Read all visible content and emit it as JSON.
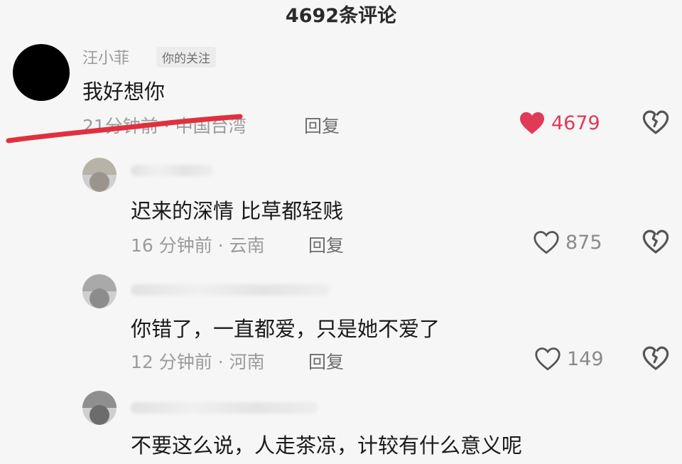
{
  "header": {
    "title": "4692条评论"
  },
  "colors": {
    "like_active": "#e03a58",
    "annotation_line": "#e0303f"
  },
  "comments": [
    {
      "name": "汪小菲",
      "tag": "你的关注",
      "text": "我好想你",
      "meta": "21分钟前 · 中国台湾",
      "reply": "回复",
      "likes": "4679",
      "liked": true
    },
    {
      "name": "",
      "text": "迟来的深情 比草都轻贱",
      "meta": "16 分钟前 · 云南",
      "reply": "回复",
      "likes": "875",
      "liked": false
    },
    {
      "name": "",
      "text": "你错了，一直都爱，只是她不爱了",
      "meta": "12 分钟前 · 河南",
      "reply": "回复",
      "likes": "149",
      "liked": false
    },
    {
      "name": "",
      "text": "不要这么说，人走茶凉，计较有什么意义呢"
    }
  ]
}
